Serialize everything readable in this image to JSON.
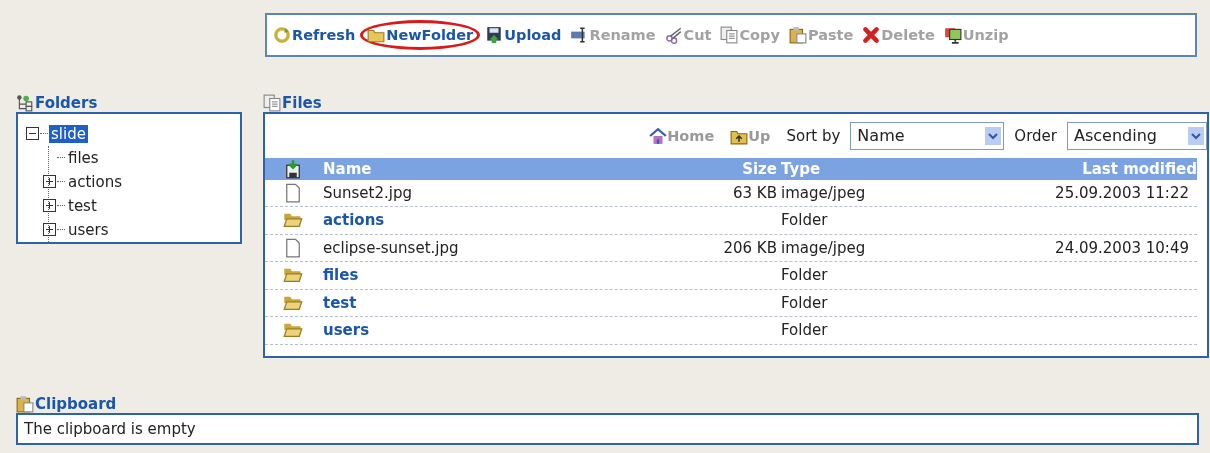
{
  "toolbar": [
    {
      "label": "Refresh",
      "kind": "refresh",
      "disabled": false,
      "highlighted": false
    },
    {
      "label": "NewFolder",
      "kind": "folder",
      "disabled": false,
      "highlighted": true
    },
    {
      "label": "Upload",
      "kind": "upload",
      "disabled": false,
      "highlighted": false
    },
    {
      "label": "Rename",
      "kind": "rename",
      "disabled": true,
      "highlighted": false
    },
    {
      "label": "Cut",
      "kind": "cut",
      "disabled": true,
      "highlighted": false
    },
    {
      "label": "Copy",
      "kind": "copy",
      "disabled": true,
      "highlighted": false
    },
    {
      "label": "Paste",
      "kind": "paste",
      "disabled": true,
      "highlighted": false
    },
    {
      "label": "Delete",
      "kind": "delete",
      "disabled": true,
      "highlighted": false
    },
    {
      "label": "Unzip",
      "kind": "unzip",
      "disabled": true,
      "highlighted": false
    }
  ],
  "folders": {
    "title": "Folders",
    "tree": [
      {
        "label": "slide",
        "selected": true,
        "expanded": true,
        "children": [
          {
            "label": "files",
            "selected": false
          },
          {
            "label": "actions",
            "selected": false,
            "expanded": false
          },
          {
            "label": "test",
            "selected": false,
            "expanded": false
          },
          {
            "label": "users",
            "selected": false,
            "expanded": false
          }
        ]
      }
    ]
  },
  "files": {
    "title": "Files",
    "nav": [
      {
        "label": "Home",
        "kind": "home"
      },
      {
        "label": "Up",
        "kind": "up"
      }
    ],
    "sort_by": {
      "label": "Sort by",
      "value": "Name"
    },
    "order": {
      "label": "Order",
      "value": "Ascending"
    },
    "columns": [
      "Name",
      "Size",
      "Type",
      "Last modified"
    ],
    "rows": [
      {
        "kind": "file",
        "name": "Sunset2.jpg",
        "size": "63 KB",
        "type": "image/jpeg",
        "modified": "25.09.2003 11:22"
      },
      {
        "kind": "folder",
        "name": "actions",
        "type": "Folder"
      },
      {
        "kind": "file",
        "name": "eclipse-sunset.jpg",
        "size": "206 KB",
        "type": "image/jpeg",
        "modified": "24.09.2003 10:49"
      },
      {
        "kind": "folder",
        "name": "files",
        "type": "Folder"
      },
      {
        "kind": "folder",
        "name": "test",
        "type": "Folder"
      },
      {
        "kind": "folder",
        "name": "users",
        "type": "Folder"
      }
    ]
  },
  "clipboard": {
    "title": "Clipboard",
    "text": "The clipboard is empty"
  }
}
